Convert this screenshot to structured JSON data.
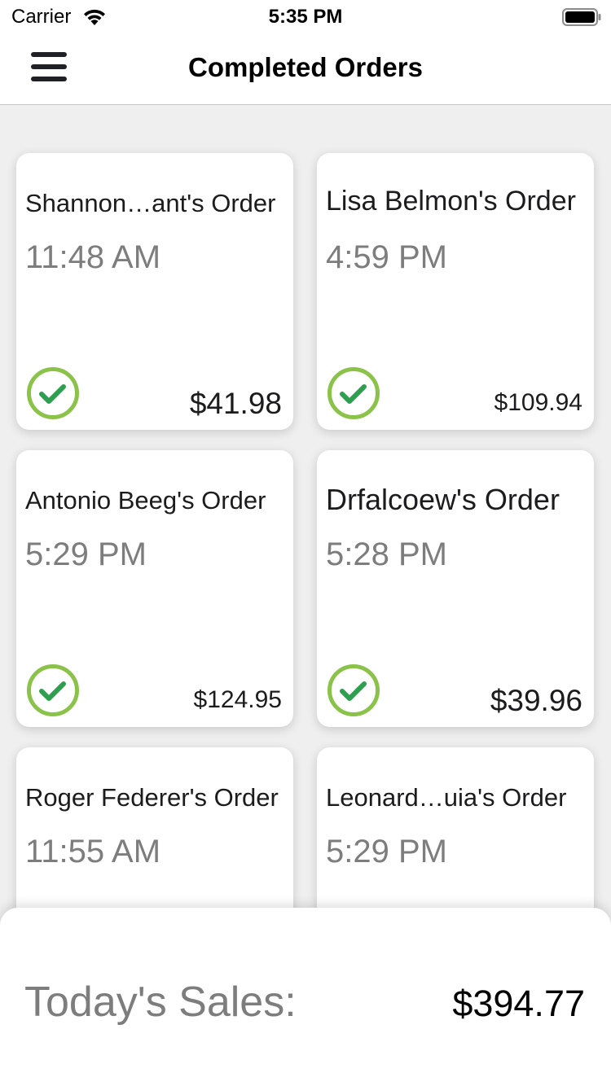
{
  "status_bar": {
    "carrier": "Carrier",
    "time": "5:35 PM",
    "wifi_icon": "wifi-icon",
    "battery_icon": "battery-icon"
  },
  "nav": {
    "title": "Completed Orders",
    "menu_icon": "hamburger-menu-icon"
  },
  "orders": [
    {
      "name": "Shannon…ant's Order",
      "time": "11:48 AM",
      "total": "$41.98",
      "completed": true
    },
    {
      "name": "Lisa Belmon's Order",
      "time": "4:59 PM",
      "total": "$109.94",
      "completed": true
    },
    {
      "name": "Antonio Beeg's Order",
      "time": "5:29 PM",
      "total": "$124.95",
      "completed": true
    },
    {
      "name": "Drfalcoew's Order",
      "time": "5:28 PM",
      "total": "$39.96",
      "completed": true
    },
    {
      "name": "Roger Federer's Order",
      "time": "11:55 AM",
      "total": "",
      "completed": true
    },
    {
      "name": "Leonard…uia's Order",
      "time": "5:29 PM",
      "total": "",
      "completed": true
    }
  ],
  "sales": {
    "label": "Today's Sales:",
    "value": "$394.77"
  },
  "colors": {
    "check_ring": "#8bc34a",
    "check_mark": "#2e9e4f",
    "time_text": "#7d7d7d",
    "background": "#efefef"
  }
}
